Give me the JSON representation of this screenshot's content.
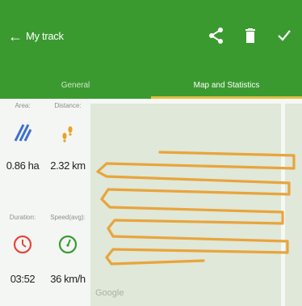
{
  "header": {
    "title": "My track",
    "actions": [
      "share-icon",
      "delete-icon",
      "check-icon"
    ]
  },
  "tabs": [
    {
      "label": "General",
      "active": false
    },
    {
      "label": "Map and Statistics",
      "active": true
    }
  ],
  "stats": {
    "area": {
      "label": "Area:",
      "value": "0.86 ha",
      "icon": "area-hatch-icon"
    },
    "distance": {
      "label": "Distance:",
      "value": "2.32 km",
      "icon": "footsteps-icon"
    },
    "duration": {
      "label": "Duration:",
      "value": "03:52",
      "icon": "clock-icon"
    },
    "speed": {
      "label": "Speed(avg):",
      "value": "36 km/h",
      "icon": "speedometer-icon"
    }
  },
  "map": {
    "attribution": "Google",
    "track_color": "#e9a43c"
  },
  "colors": {
    "appbar": "#3a9a30",
    "tab_indicator": "#e0c040",
    "area_icon": "#3f6fd0",
    "distance_icon": "#e7a22e",
    "clock_icon": "#e8453b",
    "speed_icon": "#3a9a30"
  }
}
